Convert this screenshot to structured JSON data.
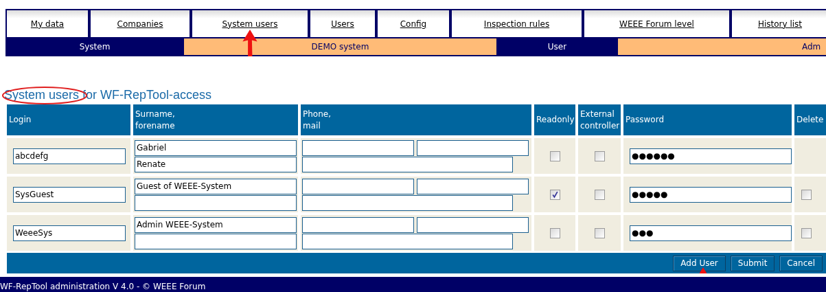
{
  "nav": {
    "tabs": [
      {
        "label": "My data",
        "selected": false,
        "arrow": false
      },
      {
        "label": "Companies",
        "selected": false,
        "arrow": false
      },
      {
        "label": "System users",
        "selected": false,
        "arrow": true
      },
      {
        "label": "Users",
        "selected": false,
        "arrow": false
      },
      {
        "label": "Config",
        "selected": false,
        "arrow": false
      },
      {
        "label": "Inspection rules",
        "selected": false,
        "arrow": false
      },
      {
        "label": "WEEE Forum level",
        "selected": false,
        "arrow": false
      },
      {
        "label": "History list",
        "selected": false,
        "arrow": false
      }
    ],
    "status": [
      {
        "text": "System",
        "kind": "label"
      },
      {
        "text": "DEMO system",
        "kind": "value"
      },
      {
        "text": "User",
        "kind": "label"
      },
      {
        "text": "Adm",
        "kind": "value"
      }
    ]
  },
  "heading": {
    "text": "System users for WF-RepTool-access",
    "circled": true
  },
  "table": {
    "columns": [
      "Login",
      "Surname,\nforename",
      "Phone,\nmail",
      "Readonly",
      "External\ncontroller",
      "Password",
      "Delete"
    ],
    "rows": [
      {
        "login": "abcdefg",
        "surname": "Gabriel",
        "forename": "Renate",
        "readonly": false,
        "external_controller": false,
        "password": "●●●●●●",
        "deletable": false
      },
      {
        "login": "SysGuest",
        "surname": "Guest of WEEE-System",
        "readonly": true,
        "external_controller": false,
        "password": "●●●●●",
        "deletable": true,
        "delete": false
      },
      {
        "login": "WeeeSys",
        "surname": "Admin WEEE-System",
        "readonly": false,
        "external_controller": false,
        "password": "●●●",
        "deletable": true,
        "delete": false
      }
    ],
    "buttons": [
      {
        "label": "Add User",
        "arrow": true
      },
      {
        "label": "Submit",
        "arrow": false
      },
      {
        "label": "Cancel",
        "arrow": false
      }
    ]
  },
  "footer": "WF-RepTool administration V 4.0 - © WEEE Forum"
}
